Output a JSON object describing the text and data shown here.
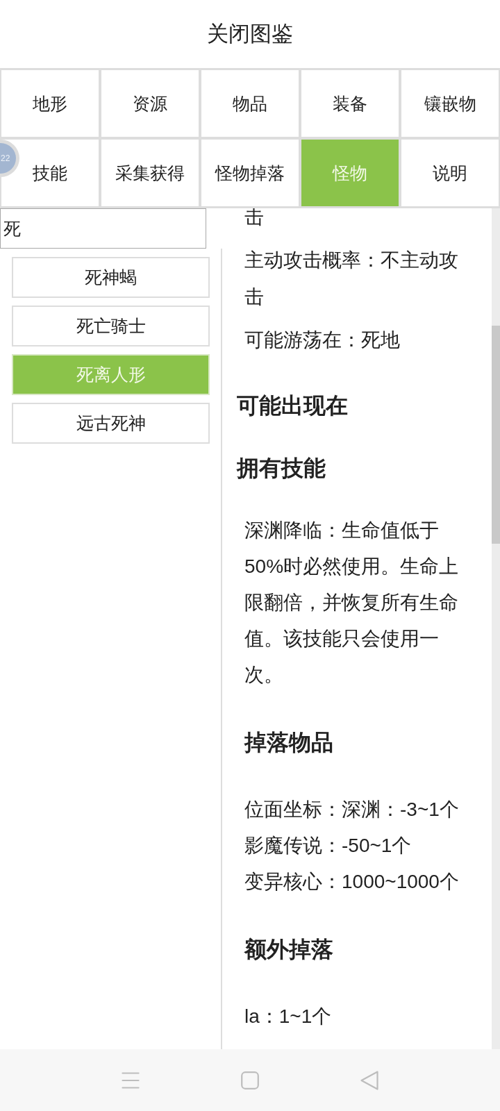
{
  "header": {
    "title": "关闭图鉴"
  },
  "floating_ball": {
    "text": "22"
  },
  "tabs": [
    {
      "label": "地形",
      "selected": false
    },
    {
      "label": "资源",
      "selected": false
    },
    {
      "label": "物品",
      "selected": false
    },
    {
      "label": "装备",
      "selected": false
    },
    {
      "label": "镶嵌物",
      "selected": false
    },
    {
      "label": "技能",
      "selected": false
    },
    {
      "label": "采集获得",
      "selected": false
    },
    {
      "label": "怪物掉落",
      "selected": false
    },
    {
      "label": "怪物",
      "selected": true
    },
    {
      "label": "说明",
      "selected": false
    }
  ],
  "search": {
    "value": "死"
  },
  "results": [
    {
      "label": "死神蝎",
      "selected": false
    },
    {
      "label": "死亡骑士",
      "selected": false
    },
    {
      "label": "死离人形",
      "selected": true
    },
    {
      "label": "远古死神",
      "selected": false
    }
  ],
  "detail": {
    "info_lines": [
      "击",
      "主动攻击概率：不主动攻击",
      "可能游荡在：死地"
    ],
    "sections": [
      {
        "title": "可能出现在"
      },
      {
        "title": "拥有技能",
        "paragraphs": [
          "深渊降临：生命值低于50%时必然使用。生命上限翻倍，并恢复所有生命值。该技能只会使用一次。"
        ]
      }
    ],
    "drop_sections": [
      {
        "title": "掉落物品",
        "entries": [
          "位面坐标：深渊：-3~1个",
          "影魔传说：-50~1个",
          "变异核心：1000~1000个"
        ]
      },
      {
        "title": "额外掉落",
        "entries": [
          "la：1~1个"
        ]
      }
    ]
  }
}
